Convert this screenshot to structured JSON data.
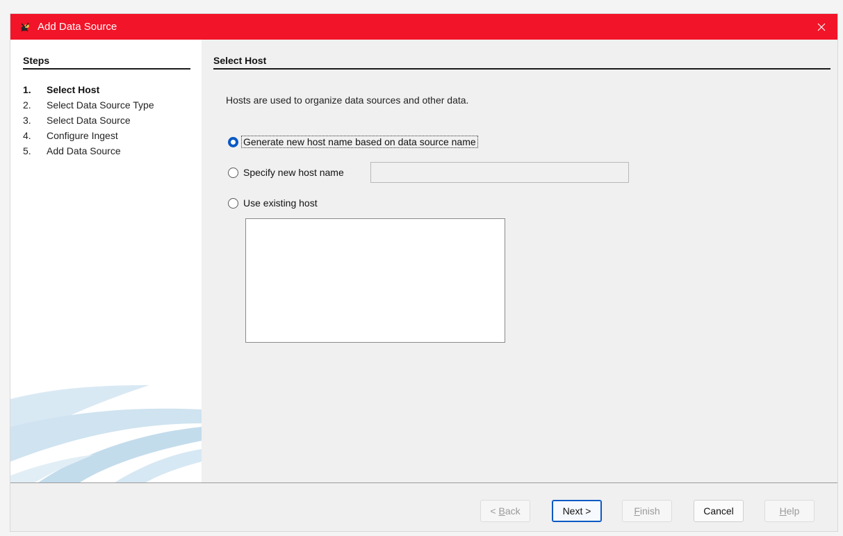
{
  "window": {
    "title": "Add Data Source",
    "accent_color": "#f21428",
    "icon": "app-icon",
    "close_icon": "close-icon"
  },
  "steps": {
    "title": "Steps",
    "items": [
      {
        "num": "1.",
        "label": "Select Host",
        "current": true
      },
      {
        "num": "2.",
        "label": "Select Data Source Type",
        "current": false
      },
      {
        "num": "3.",
        "label": "Select Data Source",
        "current": false
      },
      {
        "num": "4.",
        "label": "Configure Ingest",
        "current": false
      },
      {
        "num": "5.",
        "label": "Add Data Source",
        "current": false
      }
    ]
  },
  "main": {
    "section_title": "Select Host",
    "description": "Hosts are used to organize data sources and other data.",
    "options": {
      "generate": {
        "label": "Generate new host name based on data source name",
        "selected": true
      },
      "specify": {
        "label": "Specify new host name",
        "selected": false,
        "value": ""
      },
      "existing": {
        "label": "Use existing host",
        "selected": false,
        "hosts": []
      }
    }
  },
  "buttons": {
    "back": {
      "pre": "< ",
      "mn": "B",
      "rest": "ack",
      "enabled": false
    },
    "next": {
      "label": "Next >",
      "enabled": true
    },
    "finish": {
      "pre": "",
      "mn": "F",
      "rest": "inish",
      "enabled": false
    },
    "cancel": {
      "label": "Cancel",
      "enabled": true
    },
    "help": {
      "pre": "",
      "mn": "H",
      "rest": "elp",
      "enabled": false
    }
  }
}
